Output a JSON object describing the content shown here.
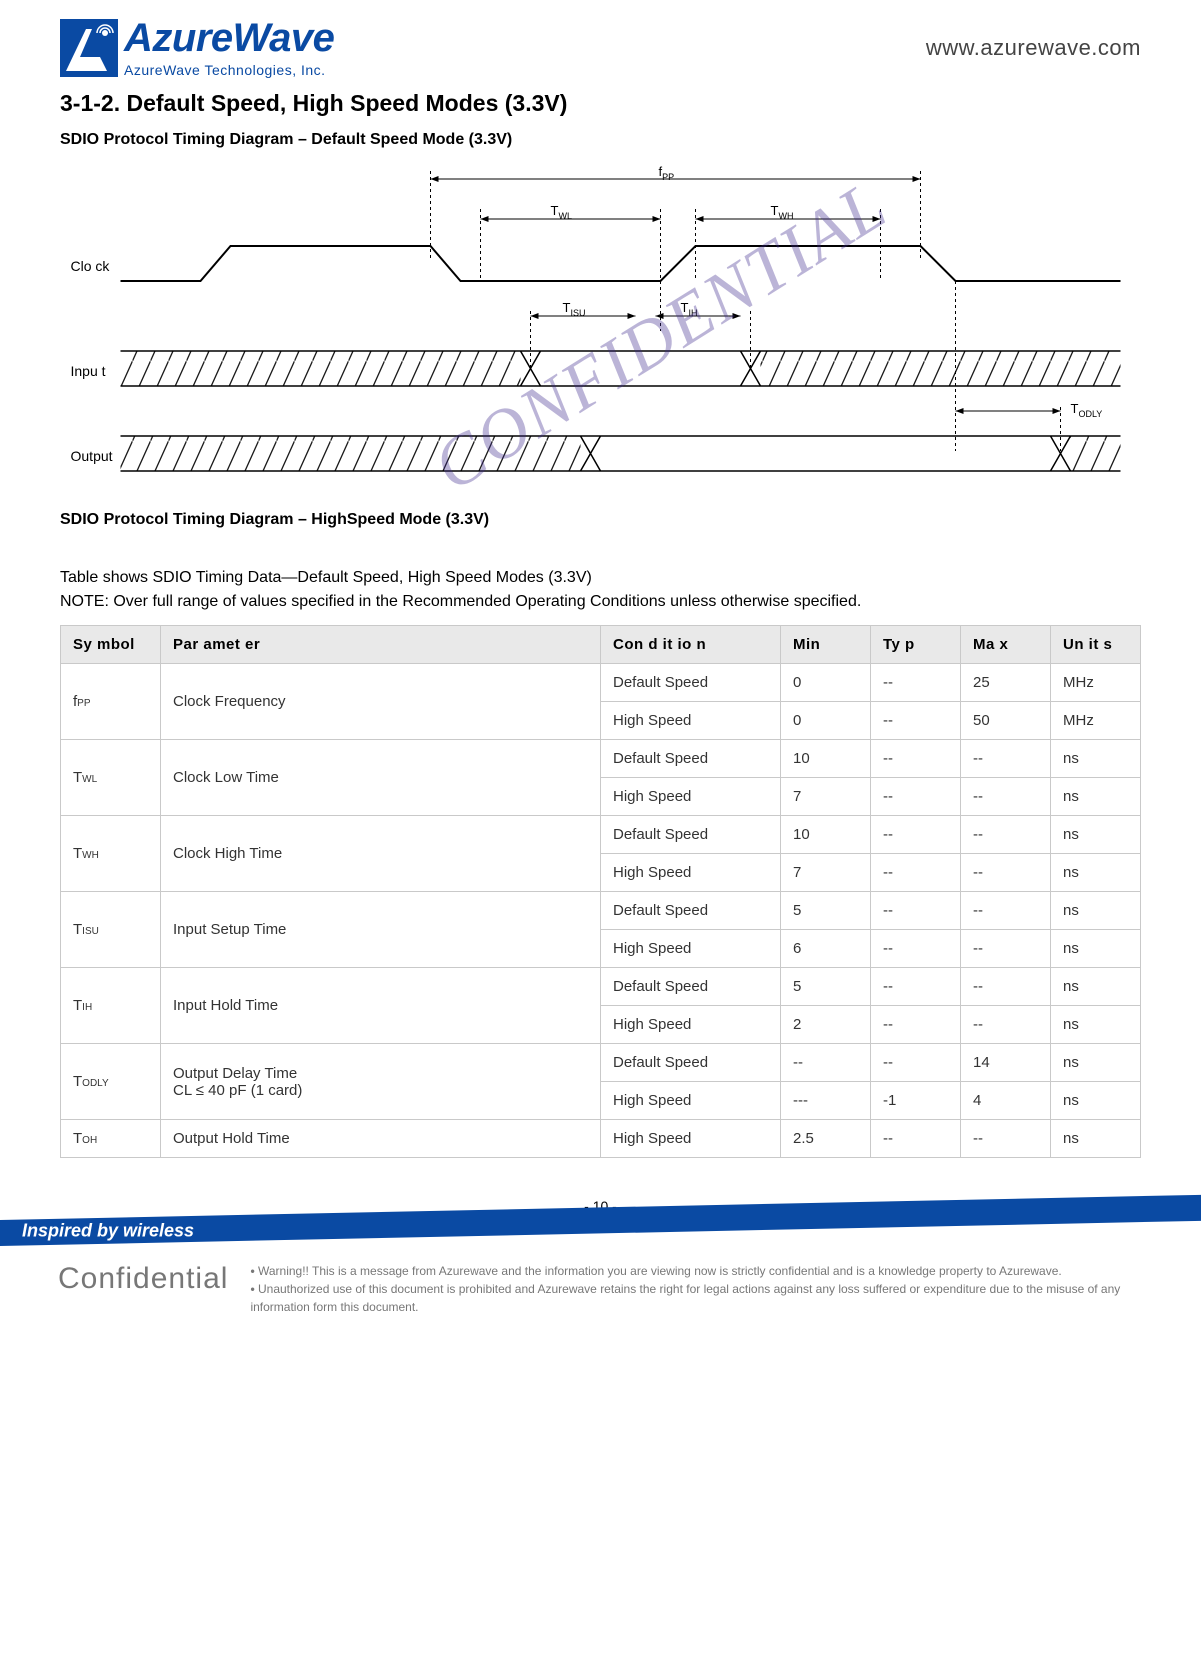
{
  "header": {
    "logo_main": "AzureWave",
    "logo_sub": "AzureWave  Technologies,  Inc.",
    "url": "www.azurewave.com"
  },
  "section_title": "3-1-2. Default Speed, High Speed Modes (3.3V)",
  "subhead1": "SDIO Protocol Timing Diagram – Default Speed Mode (3.3V)",
  "subhead2": "SDIO Protocol Timing Diagram – HighSpeed Mode (3.3V)",
  "diagram": {
    "signals": {
      "clock": "Clo ck",
      "input": "Inpu t",
      "output": "Output"
    },
    "labels": {
      "fpp": "f",
      "fpp_sub": "PP",
      "twl": "T",
      "twl_sub": "WL",
      "twh": "T",
      "twh_sub": "WH",
      "tisu": "T",
      "tisu_sub": "ISU",
      "tih": "T",
      "tih_sub": "IH",
      "todly": "T",
      "todly_sub": "ODLY"
    }
  },
  "caption": "Table shows SDIO Timing Data—Default Speed, High Speed Modes (3.3V)",
  "note": "NOTE: Over full range of values specified in the Recommended Operating Conditions unless otherwise specified.",
  "watermark": "CONFIDENTIAL",
  "table": {
    "headers": [
      "Sy mbol",
      "Par amet er",
      "Con  d it io n",
      "Min",
      "Ty p",
      "Ma x",
      "Un  it s"
    ],
    "rows": [
      {
        "sym": "f",
        "sub": "PP",
        "param": "Clock Frequency",
        "sub_rows": [
          {
            "cond": "Default Speed",
            "min": "0",
            "typ": "--",
            "max": "25",
            "units": "MHz"
          },
          {
            "cond": "High Speed",
            "min": "0",
            "typ": "--",
            "max": "50",
            "units": "MHz"
          }
        ]
      },
      {
        "sym": "T",
        "sub": "WL",
        "param": "Clock Low Time",
        "sub_rows": [
          {
            "cond": "Default Speed",
            "min": "10",
            "typ": "--",
            "max": "--",
            "units": "ns"
          },
          {
            "cond": "High Speed",
            "min": "7",
            "typ": "--",
            "max": "--",
            "units": "ns"
          }
        ]
      },
      {
        "sym": "T",
        "sub": "WH",
        "param": "Clock High Time",
        "sub_rows": [
          {
            "cond": "Default Speed",
            "min": "10",
            "typ": "--",
            "max": "--",
            "units": "ns"
          },
          {
            "cond": "High Speed",
            "min": "7",
            "typ": "--",
            "max": "--",
            "units": "ns"
          }
        ]
      },
      {
        "sym": "T",
        "sub": "ISU",
        "param": "Input Setup Time",
        "sub_rows": [
          {
            "cond": "Default Speed",
            "min": "5",
            "typ": "--",
            "max": "--",
            "units": "ns"
          },
          {
            "cond": "High Speed",
            "min": "6",
            "typ": "--",
            "max": "--",
            "units": "ns"
          }
        ]
      },
      {
        "sym": "T",
        "sub": "IH",
        "param": "Input Hold Time",
        "sub_rows": [
          {
            "cond": "Default Speed",
            "min": "5",
            "typ": "--",
            "max": "--",
            "units": "ns"
          },
          {
            "cond": "High Speed",
            "min": "2",
            "typ": "--",
            "max": "--",
            "units": "ns"
          }
        ]
      },
      {
        "sym": "T",
        "sub": "ODLY",
        "param": "Output Delay Time\nCL ≤ 40 pF (1 card)",
        "sub_rows": [
          {
            "cond": "Default Speed",
            "min": "--",
            "typ": "--",
            "max": "14",
            "units": "ns"
          },
          {
            "cond": "High Speed",
            "min": "---",
            "typ": "-1",
            "max": "  4",
            "units": "ns"
          }
        ]
      },
      {
        "sym": "T",
        "sub": "OH",
        "param": "Output Hold Time",
        "sub_rows": [
          {
            "cond": "High Speed",
            "min": "2.5",
            "typ": "--",
            "max": "--",
            "units": "ns"
          }
        ]
      }
    ]
  },
  "footer": {
    "tagline": "Inspired by wireless",
    "confidential": "Confidential",
    "warn1": "Warning!! This is a message from Azurewave and the information you are viewing now is strictly confidential and is a knowledge property to Azurewave.",
    "warn2": "Unauthorized use of this document is prohibited and Azurewave retains the right for legal actions against any loss suffered or expenditure due to the misuse of any information form this document."
  },
  "page_number": "- 10 -"
}
